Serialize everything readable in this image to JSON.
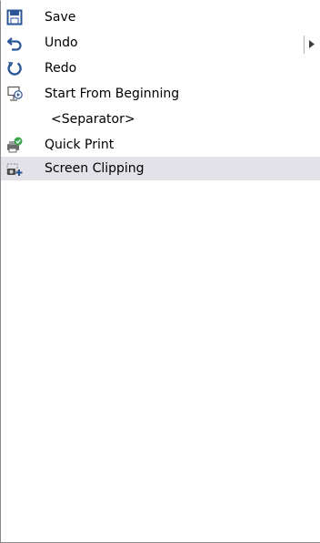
{
  "list": {
    "items": [
      {
        "label": "Save",
        "icon": "save-icon"
      },
      {
        "label": "Undo",
        "icon": "undo-icon"
      },
      {
        "label": "Redo",
        "icon": "redo-icon"
      },
      {
        "label": "Start From Beginning",
        "icon": "slideshow-start-icon"
      },
      {
        "label": "<Separator>",
        "icon": ""
      },
      {
        "label": "Quick Print",
        "icon": "quick-print-icon"
      },
      {
        "label": "Screen Clipping",
        "icon": "screen-clipping-icon",
        "selected": true
      }
    ]
  },
  "colors": {
    "icon_blue": "#2b5797",
    "selected_bg": "#e2e2e8",
    "border": "#8a8a8a"
  }
}
